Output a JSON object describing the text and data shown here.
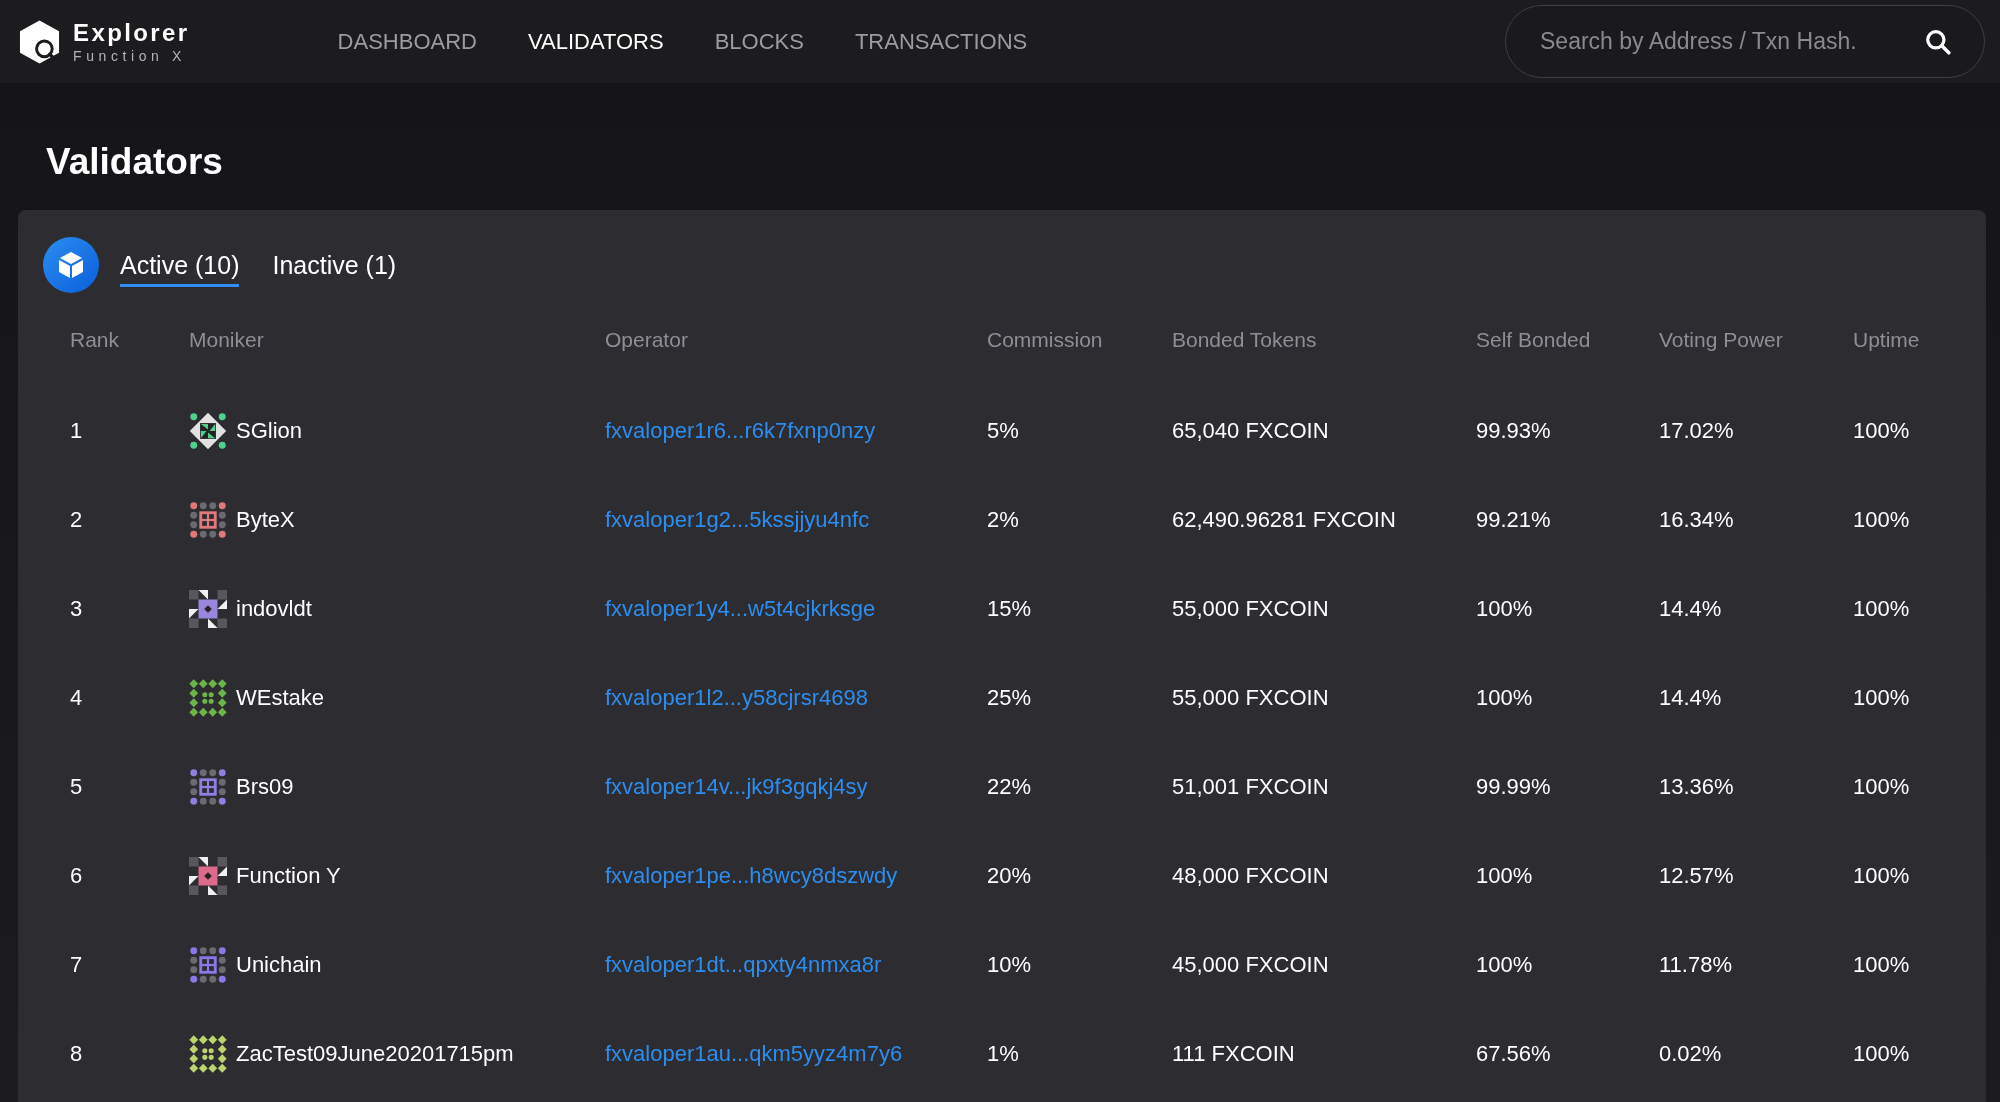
{
  "header": {
    "logo": {
      "title": "Explorer",
      "subtitle": "Function X"
    },
    "nav": [
      {
        "label": "DASHBOARD",
        "selected": false
      },
      {
        "label": "VALIDATORS",
        "selected": true
      },
      {
        "label": "BLOCKS",
        "selected": false
      },
      {
        "label": "TRANSACTIONS",
        "selected": false
      }
    ],
    "search": {
      "placeholder": "Search by Address / Txn Hash."
    }
  },
  "page_title": "Validators",
  "tabs": [
    {
      "label": "Active (10)",
      "selected": true
    },
    {
      "label": "Inactive (1)",
      "selected": false
    }
  ],
  "table": {
    "columns": [
      "Rank",
      "Moniker",
      "Operator",
      "Commission",
      "Bonded Tokens",
      "Self Bonded",
      "Voting Power",
      "Uptime"
    ],
    "rows": [
      {
        "rank": "1",
        "moniker": "SGlion",
        "color": "#4fd08c",
        "operator": "fxvaloper1r6...r6k7fxnp0nzy",
        "commission": "5%",
        "bonded_tokens": "65,040 FXCOIN",
        "self_bonded": "99.93%",
        "voting_power": "17.02%",
        "uptime": "100%"
      },
      {
        "rank": "2",
        "moniker": "ByteX",
        "color": "#e07a7a",
        "operator": "fxvaloper1g2...5kssjjyu4nfc",
        "commission": "2%",
        "bonded_tokens": "62,490.96281 FXCOIN",
        "self_bonded": "99.21%",
        "voting_power": "16.34%",
        "uptime": "100%"
      },
      {
        "rank": "3",
        "moniker": "indovldt",
        "color": "#9a86dd",
        "operator": "fxvaloper1y4...w5t4cjkrksge",
        "commission": "15%",
        "bonded_tokens": "55,000 FXCOIN",
        "self_bonded": "100%",
        "voting_power": "14.4%",
        "uptime": "100%"
      },
      {
        "rank": "4",
        "moniker": "WEstake",
        "color": "#6cb548",
        "operator": "fxvaloper1l2...y58cjrsr4698",
        "commission": "25%",
        "bonded_tokens": "55,000 FXCOIN",
        "self_bonded": "100%",
        "voting_power": "14.4%",
        "uptime": "100%"
      },
      {
        "rank": "5",
        "moniker": "Brs09",
        "color": "#8f7fe0",
        "operator": "fxvaloper14v...jk9f3gqkj4sy",
        "commission": "22%",
        "bonded_tokens": "51,001 FXCOIN",
        "self_bonded": "99.99%",
        "voting_power": "13.36%",
        "uptime": "100%"
      },
      {
        "rank": "6",
        "moniker": "Function Y",
        "color": "#dc6a8c",
        "operator": "fxvaloper1pe...h8wcy8dszwdy",
        "commission": "20%",
        "bonded_tokens": "48,000 FXCOIN",
        "self_bonded": "100%",
        "voting_power": "12.57%",
        "uptime": "100%"
      },
      {
        "rank": "7",
        "moniker": "Unichain",
        "color": "#8a78e8",
        "operator": "fxvaloper1dt...qpxty4nmxa8r",
        "commission": "10%",
        "bonded_tokens": "45,000 FXCOIN",
        "self_bonded": "100%",
        "voting_power": "11.78%",
        "uptime": "100%"
      },
      {
        "rank": "8",
        "moniker": "ZacTest09June20201715pm",
        "color": "#bcd46c",
        "operator": "fxvaloper1au...qkm5yyz4m7y6",
        "commission": "1%",
        "bonded_tokens": "111 FXCOIN",
        "self_bonded": "67.56%",
        "voting_power": "0.02%",
        "uptime": "100%"
      }
    ]
  }
}
